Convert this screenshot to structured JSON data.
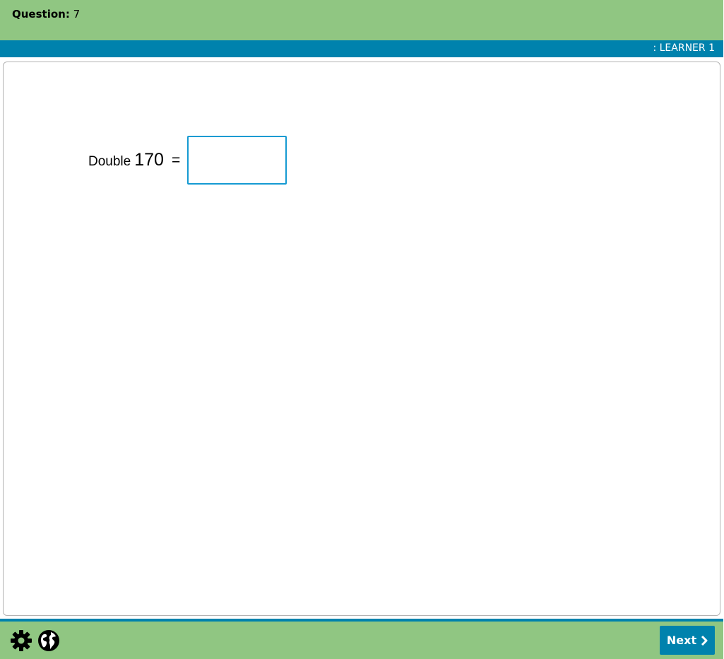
{
  "header": {
    "question_label": "Question:",
    "question_number": "7"
  },
  "learner_bar": {
    "learner_name": ": LEARNER 1"
  },
  "problem": {
    "operation_word": "Double",
    "number": "170",
    "equals": "=",
    "answer_value": "",
    "answer_placeholder": ""
  },
  "footer": {
    "settings_icon": "gear-icon",
    "language_icon": "globe-icon",
    "next_label": "Next",
    "next_icon": "chevron-right-icon"
  },
  "colors": {
    "header_green": "#90c682",
    "accent_blue": "#0082ad",
    "input_border": "#159ad2"
  }
}
